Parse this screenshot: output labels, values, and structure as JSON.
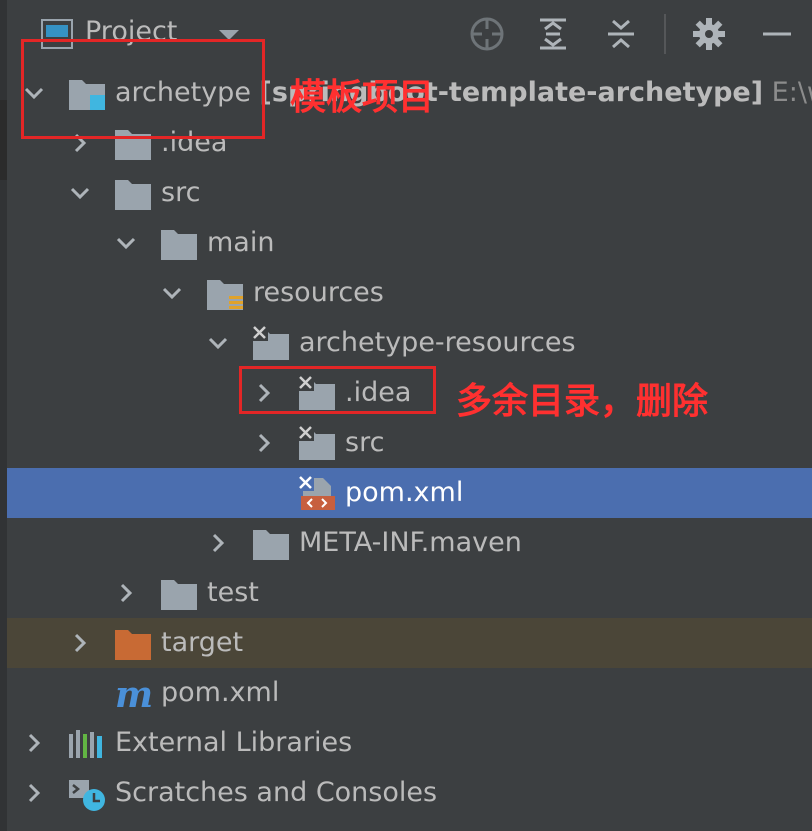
{
  "header": {
    "title": "Project",
    "icons": [
      "window-icon",
      "dropdown-caret-icon",
      "locate-target-icon",
      "expand-all-icon",
      "collapse-all-icon",
      "gear-icon",
      "minimize-icon"
    ]
  },
  "tree": [
    {
      "label": "archetype",
      "label_bold": "[springboot-template-archetype]",
      "label_path": "E:\\wo",
      "icon": "module-folder-icon",
      "expanded": true
    },
    {
      "label": ".idea",
      "icon": "folder-icon",
      "expanded": false
    },
    {
      "label": "src",
      "icon": "folder-icon",
      "expanded": true
    },
    {
      "label": "main",
      "icon": "folder-icon",
      "expanded": true
    },
    {
      "label": "resources",
      "icon": "resources-folder-icon",
      "expanded": true
    },
    {
      "label": "archetype-resources",
      "icon": "excluded-folder-icon",
      "expanded": true
    },
    {
      "label": ".idea",
      "icon": "excluded-folder-icon",
      "expanded": false
    },
    {
      "label": "src",
      "icon": "excluded-folder-icon",
      "expanded": false
    },
    {
      "label": "pom.xml",
      "icon": "xml-file-icon",
      "selected": true
    },
    {
      "label": "META-INF.maven",
      "icon": "folder-icon",
      "expanded": false
    },
    {
      "label": "test",
      "icon": "folder-icon",
      "expanded": false
    },
    {
      "label": "target",
      "icon": "target-folder-icon",
      "expanded": false
    },
    {
      "label": "pom.xml",
      "icon": "maven-icon"
    },
    {
      "label": "External Libraries",
      "icon": "libraries-icon",
      "expanded": false
    },
    {
      "label": "Scratches and Consoles",
      "icon": "scratches-icon",
      "expanded": false
    }
  ],
  "annotations": {
    "template_project": "模板项目",
    "redundant_dir": "多余目录，删除"
  },
  "colors": {
    "panel_bg": "#3c3f41",
    "selected_row": "#4b6eaf",
    "excluded_row": "#4b4638",
    "annotation_red": "#ff3030",
    "folder_gray": "#9aa4ad",
    "target_orange": "#c86a34"
  }
}
